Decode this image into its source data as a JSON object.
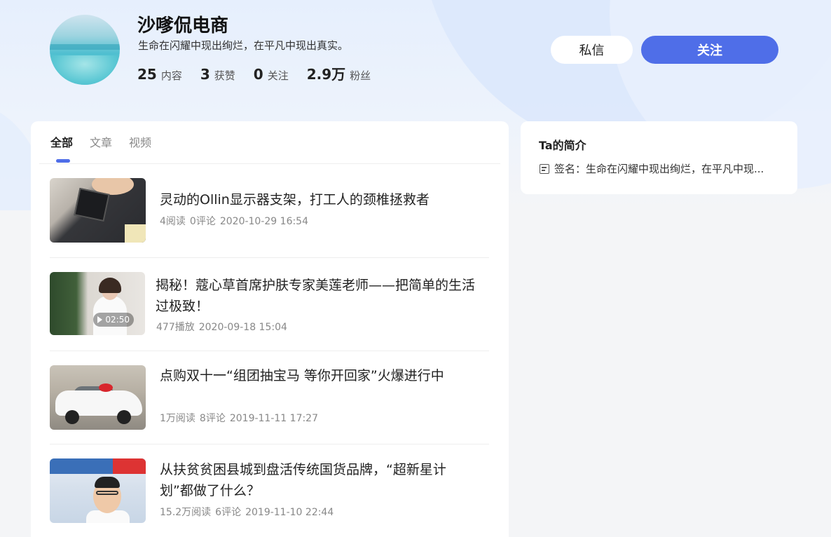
{
  "profile": {
    "name": "沙嗲侃电商",
    "bio": "生命在闪耀中现出绚烂，在平凡中现出真实。",
    "stats": [
      {
        "num": "25",
        "label": "内容"
      },
      {
        "num": "3",
        "label": "获赞"
      },
      {
        "num": "0",
        "label": "关注"
      },
      {
        "num": "2.9万",
        "label": "粉丝"
      }
    ]
  },
  "actions": {
    "message_label": "私信",
    "follow_label": "关注"
  },
  "tabs": [
    {
      "label": "全部",
      "active": true
    },
    {
      "label": "文章",
      "active": false
    },
    {
      "label": "视频",
      "active": false
    }
  ],
  "feed": [
    {
      "title": "灵动的Ollin显示器支架，打工人的颈椎拯救者",
      "views": "4阅读",
      "comments": "0评论",
      "time": "2020-10-29 16:54"
    },
    {
      "title": "揭秘！蔻心草首席护肤专家美莲老师——把简单的生活过极致！",
      "views": "477播放",
      "time": "2020-09-18 15:04",
      "duration": "02:50"
    },
    {
      "title": "点购双十一“组团抽宝马 等你开回家”火爆进行中",
      "views": "1万阅读",
      "comments": "8评论",
      "time": "2019-11-11 17:27"
    },
    {
      "title": "从扶贫贫困县城到盘活传统国货品牌，“超新星计划”都做了什么？",
      "views": "15.2万阅读",
      "comments": "6评论",
      "time": "2019-11-10 22:44"
    }
  ],
  "side": {
    "title": "Ta的简介",
    "signature": "签名：生命在闪耀中现出绚烂，在平凡中现..."
  },
  "icons": {
    "signature": "document-icon",
    "play": "play-icon"
  },
  "colors": {
    "accent": "#4f6ee8"
  }
}
